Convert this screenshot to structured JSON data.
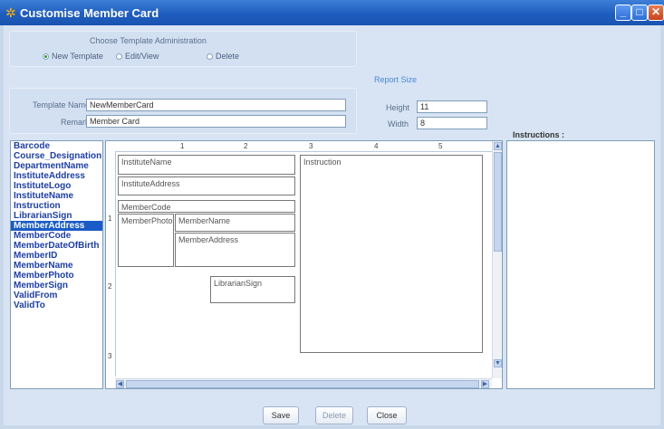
{
  "window": {
    "title": "Customise Member Card",
    "minimize": "_",
    "maximize": "□",
    "close": "✕"
  },
  "template_admin": {
    "heading": "Choose Template Administration",
    "options": [
      "New Template",
      "Edit/View",
      "Delete"
    ],
    "selected": "New Template"
  },
  "template": {
    "name_label": "Template Name",
    "name_value": "NewMemberCard",
    "remark_label": "Remark",
    "remark_value": "Member Card"
  },
  "report_size": {
    "heading": "Report Size",
    "height_label": "Height",
    "height_value": "11",
    "width_label": "Width",
    "width_value": "8"
  },
  "fields": [
    "Barcode",
    "Course_Designation",
    "DepartmentName",
    "InstituteAddress",
    "InstituteLogo",
    "InstituteName",
    "Instruction",
    "LibrarianSign",
    "MemberAddress",
    "MemberCode",
    "MemberDateOfBirth",
    "MemberID",
    "MemberName",
    "MemberPhoto",
    "MemberSign",
    "ValidFrom",
    "ValidTo"
  ],
  "selected_field": "MemberAddress",
  "ruler": {
    "h_marks": [
      "1",
      "2",
      "3",
      "4",
      "5"
    ],
    "v_marks": [
      "1",
      "2",
      "3"
    ]
  },
  "canvas_boxes": {
    "institute_name": "InstituteName",
    "institute_address": "InstituteAddress",
    "member_code": "MemberCode",
    "member_photo": "MemberPhoto",
    "member_name": "MemberName",
    "member_address": "MemberAddress",
    "librarian_sign": "LibrarianSign",
    "instruction": "Instruction"
  },
  "instructions_label": "Instructions :",
  "buttons": {
    "save": "Save",
    "delete": "Delete",
    "close": "Close"
  },
  "colors": {
    "titlebar": "#1f5ebf",
    "selected_item": "#1a5cc7",
    "field_text": "#1d3fa8",
    "report_size_heading": "#4a86d6"
  }
}
